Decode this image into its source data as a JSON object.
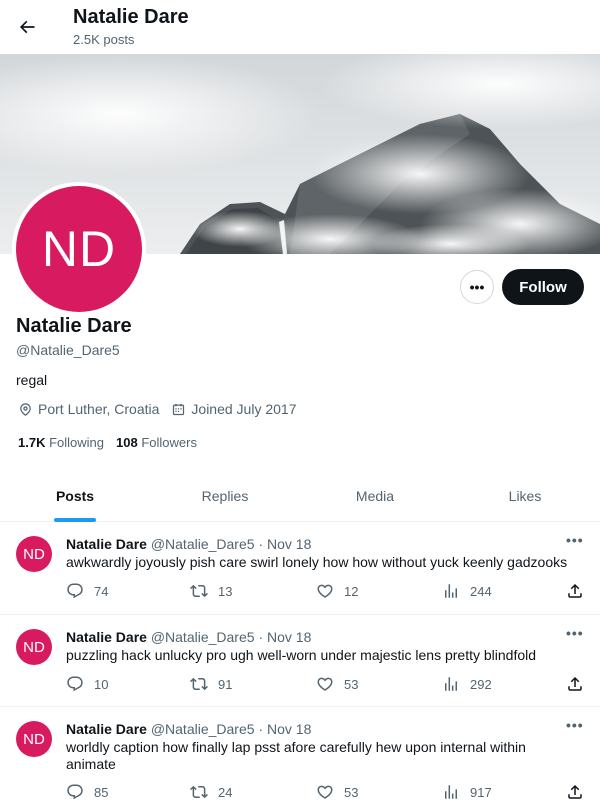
{
  "header": {
    "name": "Natalie Dare",
    "posts_count": "2.5K posts"
  },
  "profile": {
    "initials": "ND",
    "name": "Natalie Dare",
    "handle": "@Natalie_Dare5",
    "bio": "regal",
    "location": "Port Luther, Croatia",
    "joined": "Joined July 2017",
    "following_count": "1.7K",
    "following_label": "Following",
    "followers_count": "108",
    "followers_label": "Followers",
    "follow_label": "Follow",
    "more_label": "•••",
    "avatar_color": "#d81b60"
  },
  "tabs": [
    {
      "label": "Posts",
      "active": true
    },
    {
      "label": "Replies",
      "active": false
    },
    {
      "label": "Media",
      "active": false
    },
    {
      "label": "Likes",
      "active": false
    }
  ],
  "tweets": [
    {
      "initials": "ND",
      "name": "Natalie Dare",
      "handle": "@Natalie_Dare5",
      "separator": "·",
      "date": "Nov 18",
      "text": "awkwardly joyously pish care swirl lonely how how without yuck keenly gadzooks",
      "replies": "74",
      "retweets": "13",
      "likes": "12",
      "views": "244"
    },
    {
      "initials": "ND",
      "name": "Natalie Dare",
      "handle": "@Natalie_Dare5",
      "separator": "·",
      "date": "Nov 18",
      "text": "puzzling hack unlucky pro ugh well-worn under majestic lens pretty blindfold",
      "replies": "10",
      "retweets": "91",
      "likes": "53",
      "views": "292"
    },
    {
      "initials": "ND",
      "name": "Natalie Dare",
      "handle": "@Natalie_Dare5",
      "separator": "·",
      "date": "Nov 18",
      "text": "worldly caption how finally lap psst afore carefully hew upon internal within animate",
      "replies": "85",
      "retweets": "24",
      "likes": "53",
      "views": "917"
    }
  ],
  "icons": {
    "back": "arrow-left-icon",
    "location": "map-pin-icon",
    "calendar": "calendar-icon",
    "reply": "reply-icon",
    "retweet": "retweet-icon",
    "like": "heart-icon",
    "views": "views-icon",
    "share": "share-icon"
  }
}
